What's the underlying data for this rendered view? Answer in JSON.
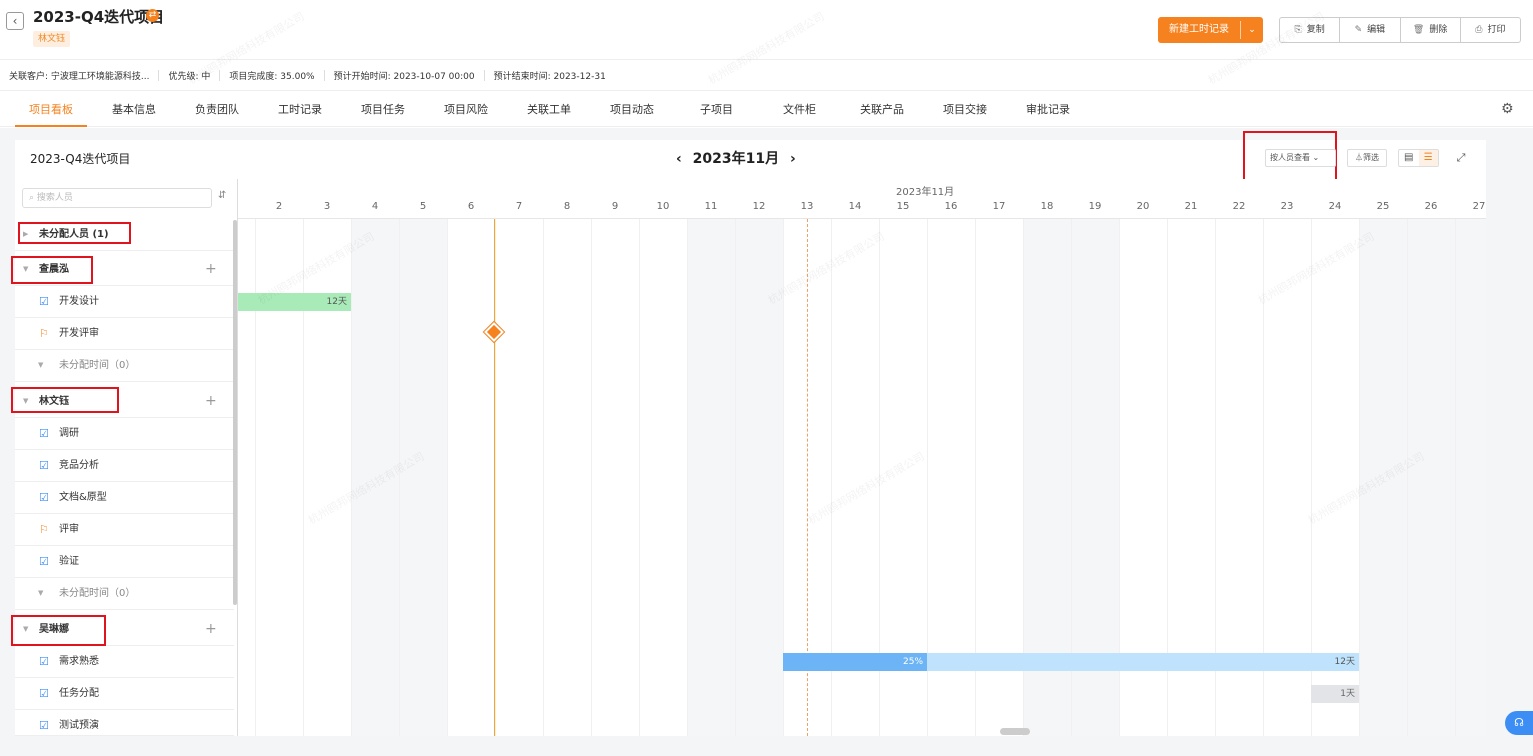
{
  "header": {
    "title": "2023-Q4迭代项目",
    "owner_tag": "林文钰",
    "new_button": "新建工时记录",
    "actions": [
      {
        "icon": "copy-icon",
        "label": "复制"
      },
      {
        "icon": "edit-icon",
        "label": "编辑"
      },
      {
        "icon": "delete-icon",
        "label": "删除"
      },
      {
        "icon": "print-icon",
        "label": "打印"
      }
    ]
  },
  "info": {
    "customer": "关联客户:   宁波理工环境能源科技...",
    "priority": "优先级:   中",
    "completion": "项目完成度:   35.00%",
    "start": "预计开始时间:   2023-10-07 00:00",
    "end": "预计结束时间:   2023-12-31"
  },
  "tabs": [
    "项目看板",
    "基本信息",
    "负责团队",
    "工时记录",
    "项目任务",
    "项目风险",
    "关联工单",
    "项目动态",
    "子项目",
    "文件柜",
    "关联产品",
    "项目交接",
    "审批记录"
  ],
  "board": {
    "title": "2023-Q4迭代项目",
    "month": "2023年11月",
    "view_select": "按人员查看",
    "filter": "筛选",
    "search_placeholder": "搜索人员",
    "timeline_month": "2023年11月",
    "days": [
      "2",
      "3",
      "4",
      "5",
      "6",
      "7",
      "8",
      "9",
      "10",
      "11",
      "12",
      "13",
      "14",
      "15",
      "16",
      "17",
      "18",
      "19",
      "20",
      "21",
      "22",
      "23",
      "24",
      "25",
      "26",
      "27"
    ]
  },
  "rows": [
    {
      "kind": "group",
      "label": "未分配人员 (1)",
      "collapsed": true
    },
    {
      "kind": "group",
      "label": "查晨泓"
    },
    {
      "kind": "task",
      "icon": "task-icon",
      "label": "开发设计"
    },
    {
      "kind": "task",
      "icon": "milestone-flag-icon",
      "label": "开发评审"
    },
    {
      "kind": "muted",
      "label": "未分配时间（0）"
    },
    {
      "kind": "group",
      "label": "林文钰"
    },
    {
      "kind": "task",
      "icon": "task-icon",
      "label": "调研"
    },
    {
      "kind": "task",
      "icon": "task-icon",
      "label": "竞品分析"
    },
    {
      "kind": "task",
      "icon": "task-icon",
      "label": "文档&原型"
    },
    {
      "kind": "task",
      "icon": "milestone-flag-icon",
      "label": "评审"
    },
    {
      "kind": "task",
      "icon": "task-icon",
      "label": "验证"
    },
    {
      "kind": "muted",
      "label": "未分配时间（0）"
    },
    {
      "kind": "group",
      "label": "吴琳娜"
    },
    {
      "kind": "task",
      "icon": "task-icon",
      "label": "需求熟悉"
    },
    {
      "kind": "task",
      "icon": "task-icon",
      "label": "任务分配"
    },
    {
      "kind": "task",
      "icon": "task-icon",
      "label": "测试预演"
    }
  ],
  "gantt": {
    "bar1": {
      "label": "12天"
    },
    "bar2": {
      "progress": 0.25,
      "progress_label": "25%",
      "label": "12天"
    },
    "bar3": {
      "label": "1天"
    }
  },
  "colors": {
    "accent": "#f5821f",
    "highlight_box": "#e0141e",
    "progress": "#6cb4f5"
  }
}
